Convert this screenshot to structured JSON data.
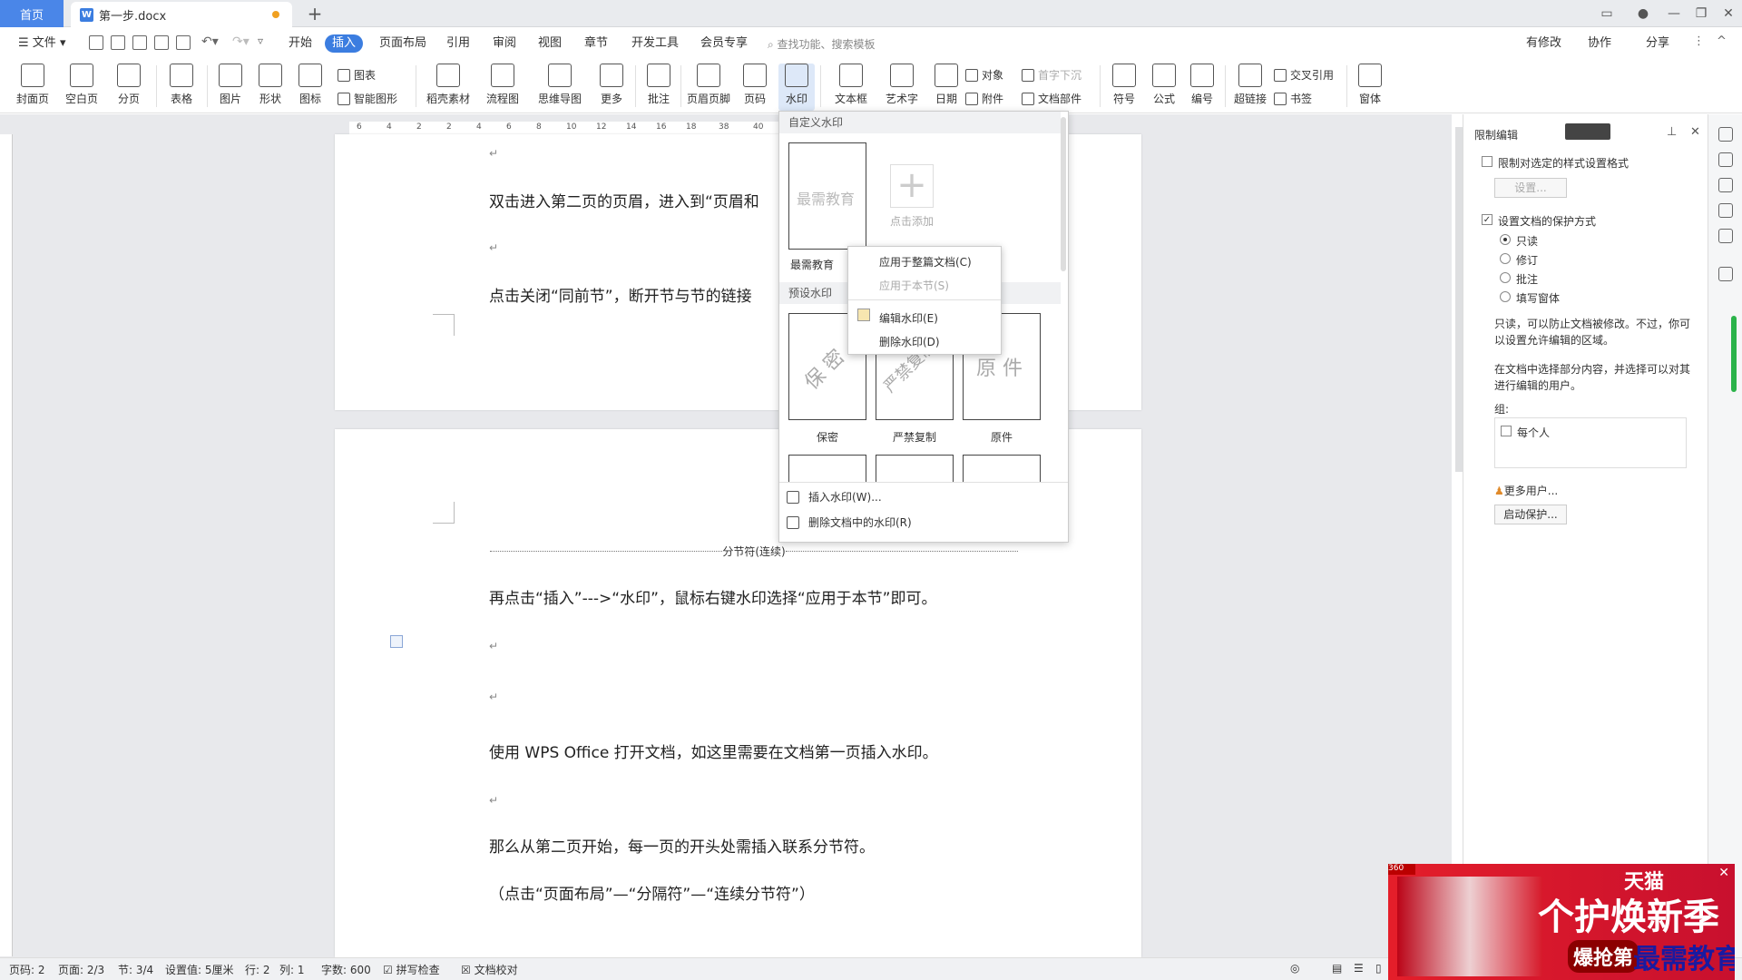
{
  "titlebar": {
    "home_tab": "首页",
    "doc_tab": "第一步.docx",
    "doc_icon": "W"
  },
  "menubar": {
    "file": "文件",
    "items": [
      "开始",
      "插入",
      "页面布局",
      "引用",
      "审阅",
      "视图",
      "章节",
      "开发工具",
      "会员专享"
    ],
    "active": "插入",
    "search": "查找功能、搜索模板",
    "right": [
      "有修改",
      "协作",
      "分享"
    ]
  },
  "ribbon": {
    "buttons": [
      "封面页",
      "空白页",
      "分页",
      "表格",
      "图片",
      "形状",
      "图标",
      "稻壳素材",
      "流程图",
      "思维导图",
      "更多",
      "批注",
      "页眉页脚",
      "页码",
      "水印",
      "文本框",
      "艺术字",
      "日期",
      "符号",
      "公式",
      "编号",
      "超链接",
      "窗体"
    ],
    "small": [
      "图表",
      "智能图形",
      "对象",
      "附件",
      "首字下沉",
      "文档部件",
      "交叉引用",
      "书签"
    ]
  },
  "ruler": {
    "ticks": [
      "6",
      "4",
      "2",
      "2",
      "4",
      "6",
      "8",
      "10",
      "12",
      "14",
      "16",
      "18",
      "38",
      "40"
    ]
  },
  "document": {
    "page1": {
      "line1": "双击进入第二页的页眉，进入到“页眉和",
      "line2": "点击关闭“同前节”，断开节与节的链接"
    },
    "section_break": "分节符(连续)",
    "page2": {
      "line1": "再点击“插入”--->“水印”，鼠标右键水印选择“应用于本节”即可。",
      "line2": "使用 WPS Office 打开文档，如这里需要在文档第一页插入水印。",
      "line3": "那么从第二页开始，每一页的开头处需插入联系分节符。",
      "line4": "（点击“页面布局”—“分隔符”—“连续分节符”）"
    },
    "para_mark": "↵"
  },
  "watermark_menu": {
    "custom_header": "自定义水印",
    "custom_item_text": "最需教育",
    "custom_item_label": "最需教育",
    "add_label": "点击添加",
    "preset_header": "预设水印",
    "presets": [
      {
        "text": "保 密",
        "label": "保密"
      },
      {
        "text": "严禁复制",
        "label": "严禁复制"
      },
      {
        "text": "原 件",
        "label": "原件"
      }
    ],
    "insert": "插入水印(W)...",
    "delete_all": "删除文档中的水印(R)"
  },
  "context_menu": {
    "apply_doc": "应用于整篇文档(C)",
    "apply_section": "应用于本节(S)",
    "edit": "编辑水印(E)",
    "delete": "删除水印(D)"
  },
  "panel": {
    "title": "限制编辑",
    "opt1": "限制对选定的样式设置格式",
    "settings_btn": "设置...",
    "opt2": "设置文档的保护方式",
    "modes": [
      "只读",
      "修订",
      "批注",
      "填写窗体"
    ],
    "selected_mode": "只读",
    "desc1": "只读，可以防止文档被修改。不过，你可以设置允许编辑的区域。",
    "desc2": "在文档中选择部分内容，并选择可以对其进行编辑的用户。",
    "group_label": "组:",
    "everyone": "每个人",
    "more_users": "更多用户...",
    "start_btn": "启动保护..."
  },
  "statusbar": {
    "page_num": "页码: 2",
    "pages": "页面: 2/3",
    "section": "节: 3/4",
    "setting": "设置值: 5厘米",
    "row": "行: 2",
    "col": "列: 1",
    "words": "字数: 600",
    "spell": "拼写检查",
    "proof": "文档校对"
  },
  "ad": {
    "brand": "天猫",
    "headline": "个护焕新季",
    "sub": "爆抢第",
    "watermark": "最需教育",
    "badge": "360"
  },
  "colors": {
    "accent": "#3b7de0",
    "ad_red": "#e41e2a"
  }
}
